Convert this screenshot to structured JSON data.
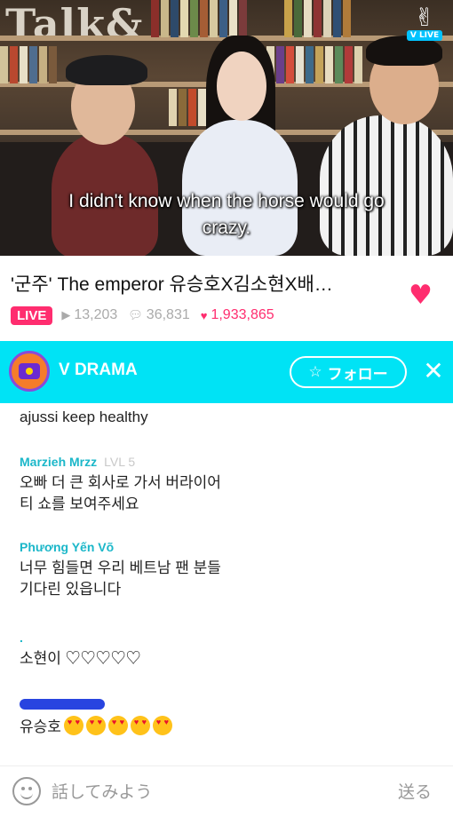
{
  "video": {
    "sign_text": "Talk&",
    "subtitle_line1": "I didn't know when the horse would go",
    "subtitle_line2": "crazy.",
    "logo_label": "V LIVE"
  },
  "info": {
    "title": "'군주' The emperor 유승호X김소현X배…",
    "live_badge": "LIVE",
    "views": "13,203",
    "comments": "36,831",
    "likes": "1,933,865"
  },
  "channel": {
    "name": "V DRAMA",
    "follow_label": "フォロー",
    "close_label": "✕"
  },
  "chat": [
    {
      "user": "",
      "level": "",
      "message": "ajussi keep healthy"
    },
    {
      "user": "Marzieh Mrzz",
      "level": "LVL 5",
      "message": "오빠 더 큰 회사로 가서 버라이어\n티 쇼를 보여주세요"
    },
    {
      "user": "Phương Yến Võ",
      "level": "",
      "message": "너무 힘들면 우리 베트남 팬 분들\n기다린 있읍니다"
    },
    {
      "user": ".",
      "level": "",
      "message": "소현이 ♡♡♡♡♡"
    },
    {
      "user": "",
      "level": "",
      "message": "유승호"
    }
  ],
  "input": {
    "placeholder": "話してみよう",
    "send_label": "送る"
  },
  "colors": {
    "accent_pink": "#ff2d6f",
    "channel_bar": "#00e3f5",
    "username": "#1bb7c9"
  }
}
